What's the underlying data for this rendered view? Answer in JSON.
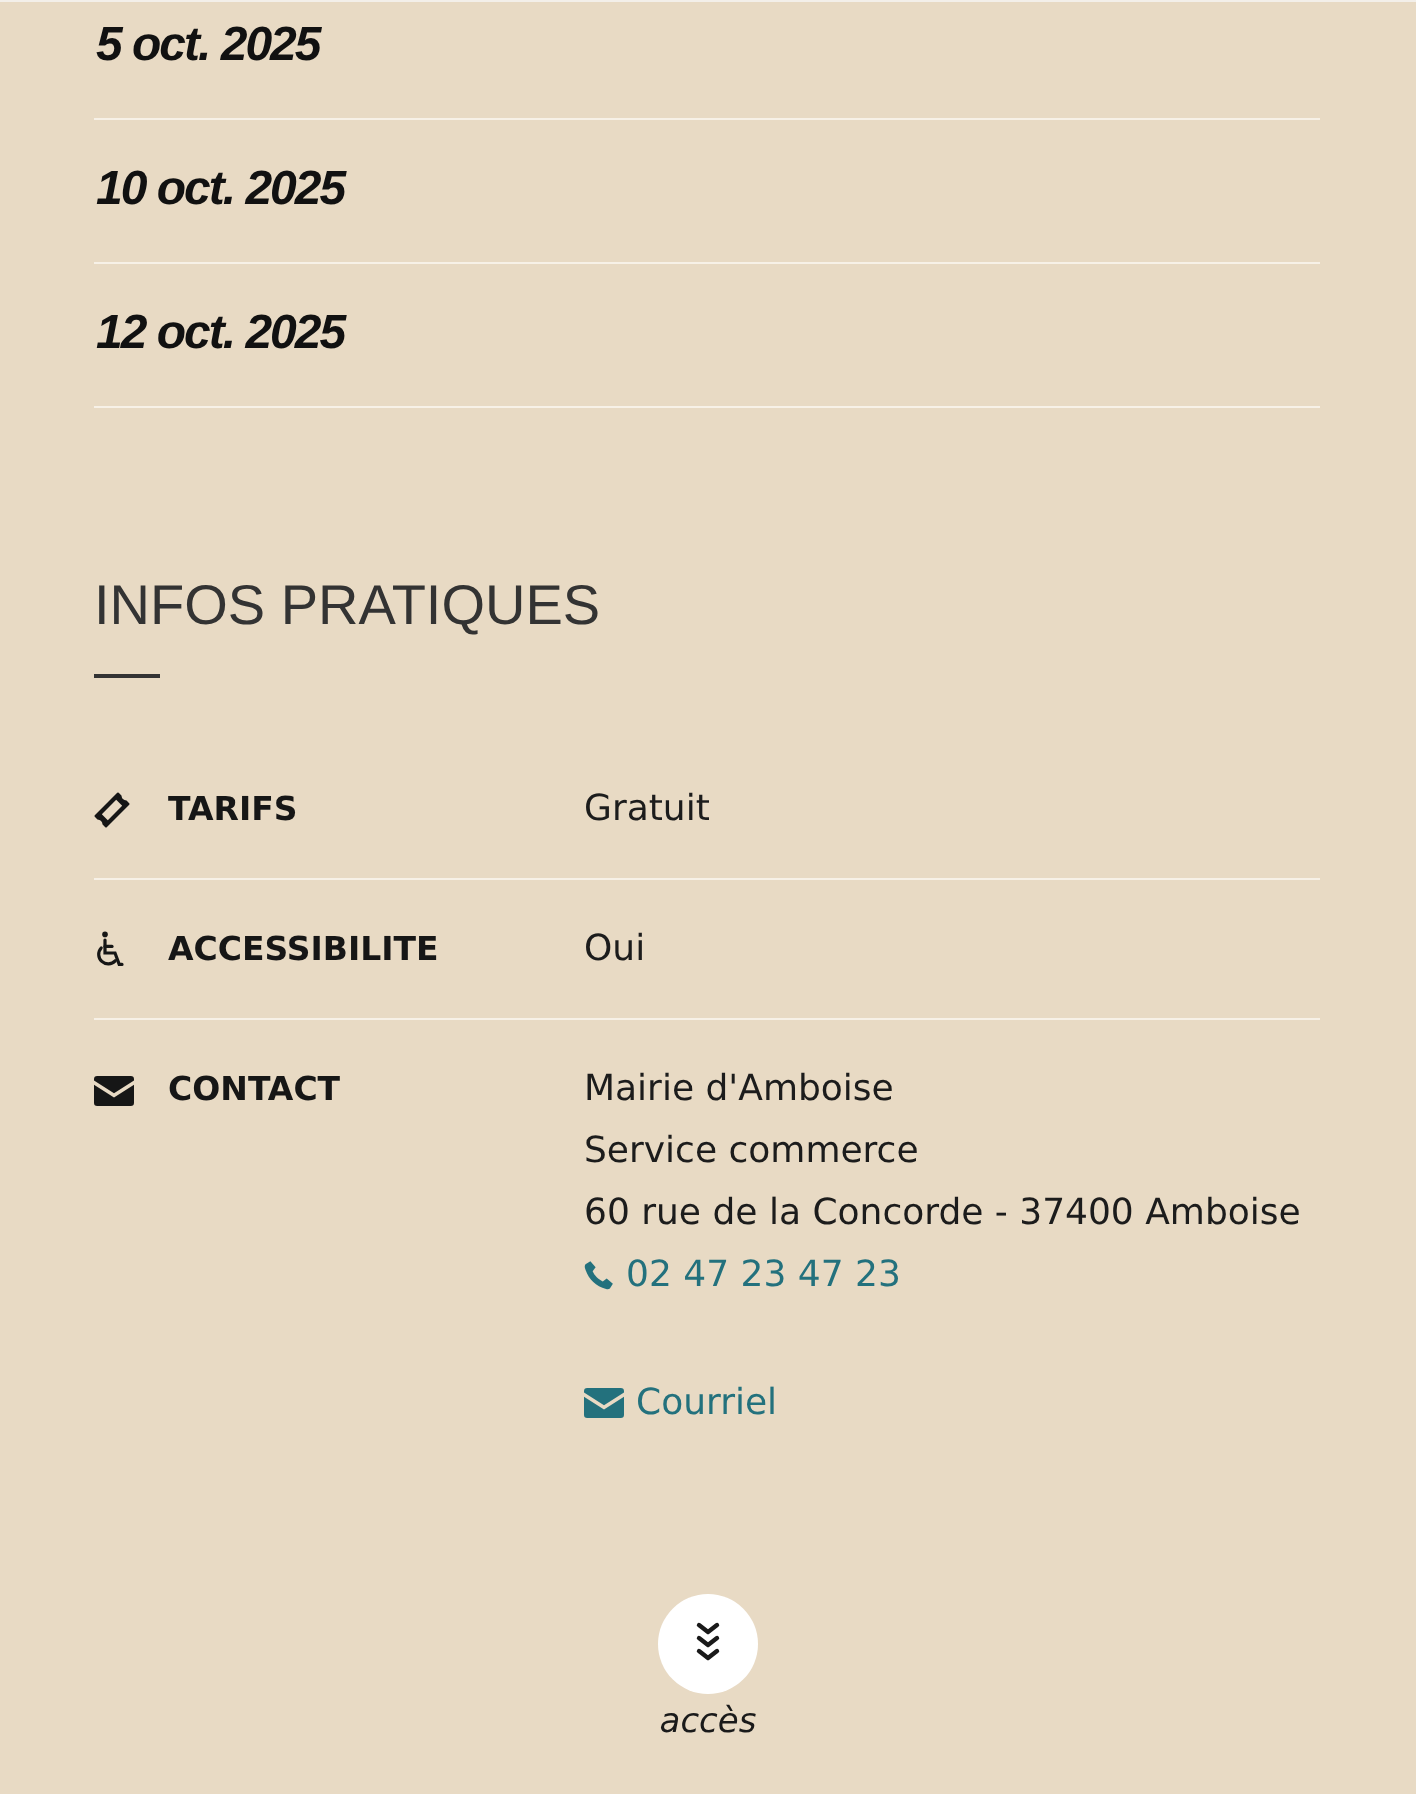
{
  "dates": [
    "5 oct. 2025",
    "10 oct. 2025",
    "12 oct. 2025"
  ],
  "practical_info": {
    "title": "INFOS PRATIQUES",
    "rows": [
      {
        "kind": "price",
        "label": "TARIFS",
        "value": "Gratuit"
      },
      {
        "kind": "accessibility",
        "label": "ACCESSIBILITE",
        "value": "Oui"
      },
      {
        "kind": "contact",
        "label": "CONTACT",
        "lines": [
          "Mairie d'Amboise",
          "Service commerce",
          "60 rue de la Concorde - 37400 Amboise"
        ],
        "links": [
          {
            "kind": "phone",
            "label": "02 47 23 47 23"
          },
          {
            "kind": "email",
            "label": "Courriel"
          }
        ]
      }
    ]
  },
  "access_link": {
    "label": "accès"
  }
}
